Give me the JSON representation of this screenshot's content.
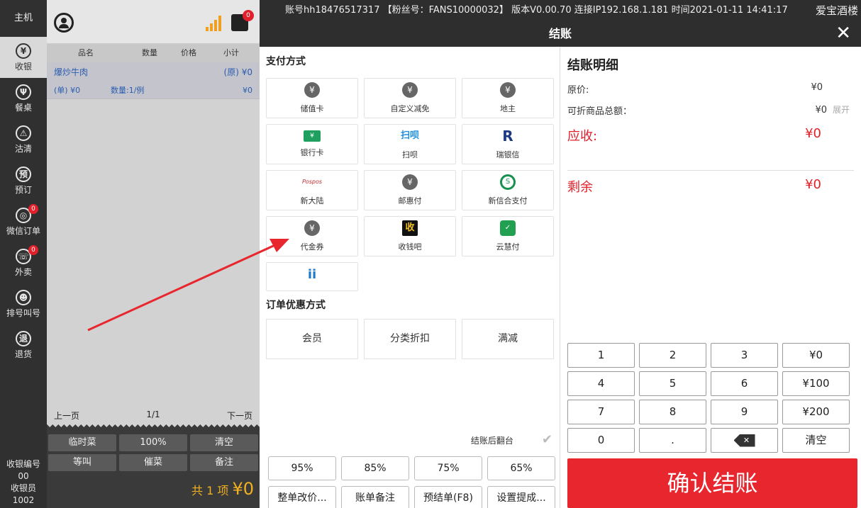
{
  "nav": {
    "top": "主机",
    "items": [
      {
        "glyph": "¥",
        "label": "收银",
        "active": true
      },
      {
        "glyph": "Ψ",
        "label": "餐桌"
      },
      {
        "glyph": "⚠",
        "label": "沽清"
      },
      {
        "glyph": "预",
        "label": "预订"
      },
      {
        "glyph": "◎",
        "label": "微信订单",
        "badge": "0"
      },
      {
        "glyph": "☏",
        "label": "外卖",
        "badge": "0"
      },
      {
        "glyph": "☻",
        "label": "排号叫号"
      },
      {
        "glyph": "退",
        "label": "退货"
      }
    ],
    "cashier_no_label": "收银编号",
    "cashier_no": "00",
    "cashier_label": "收银员",
    "cashier": "1002"
  },
  "order": {
    "printer_badge": "0",
    "cols": [
      "品名",
      "数量",
      "价格",
      "小计"
    ],
    "item": {
      "name": "爆炒牛肉",
      "orig": "(原) ¥0",
      "unit": "(单) ¥0",
      "qty": "数量:1/例",
      "sub": "¥0"
    },
    "prev": "上一页",
    "page": "1/1",
    "next": "下一页",
    "buttons": [
      "临时菜",
      "100%",
      "清空",
      "等叫",
      "催菜",
      "备注"
    ],
    "total_prefix": "共",
    "total_count": "1",
    "total_unit": "项",
    "total_amount": "¥0"
  },
  "topbar": {
    "account": "账号hh18476517317",
    "fans": "【粉丝号：FANS10000032】",
    "version": "版本V0.00.70",
    "ip": "连接IP192.168.1.181",
    "time": "时间2021-01-11 14:41:17",
    "shop": "爱宝酒楼"
  },
  "title": "结账",
  "close": "✕",
  "pay": {
    "title": "支付方式",
    "methods": [
      {
        "label": "储值卡",
        "icon": "¥"
      },
      {
        "label": "自定义减免",
        "icon": "¥"
      },
      {
        "label": "地主",
        "icon": "¥"
      },
      {
        "label": "银行卡",
        "icon": "¥"
      },
      {
        "label": "扫呗",
        "icon": "扫呗"
      },
      {
        "label": "瑞银信",
        "icon": "R"
      },
      {
        "label": "新大陆",
        "icon": "Pospos"
      },
      {
        "label": "邮惠付",
        "icon": "¥"
      },
      {
        "label": "新信合支付",
        "icon": "S"
      },
      {
        "label": "代金券",
        "icon": "¥"
      },
      {
        "label": "收钱吧",
        "icon": "收"
      },
      {
        "label": "云慧付",
        "icon": "✓"
      },
      {
        "label": "",
        "icon": "ii"
      }
    ],
    "discount_title": "订单优惠方式",
    "discounts": [
      "会员",
      "分类折扣",
      "满减"
    ],
    "flip": "结账后翻台",
    "percents": [
      "95%",
      "85%",
      "75%",
      "65%"
    ],
    "actions": [
      "整单改价...",
      "账单备注",
      "预结单(F8)",
      "设置提成..."
    ]
  },
  "detail": {
    "title": "结账明细",
    "orig_label": "原价:",
    "orig": "¥0",
    "disc_label": "可折商品总额：",
    "disc": "¥0",
    "expand": "展开",
    "due_label": "应收:",
    "due": "¥0",
    "rest_label": "剩余",
    "rest": "¥0",
    "keys": [
      "1",
      "2",
      "3",
      "¥0",
      "4",
      "5",
      "6",
      "¥100",
      "7",
      "8",
      "9",
      "¥200",
      "0",
      ".",
      "⌫",
      "清空"
    ],
    "confirm": "确认结账"
  },
  "colors": {
    "accent": "#e8262e",
    "nav_bg": "#303030",
    "arrow": "#e8262e"
  }
}
